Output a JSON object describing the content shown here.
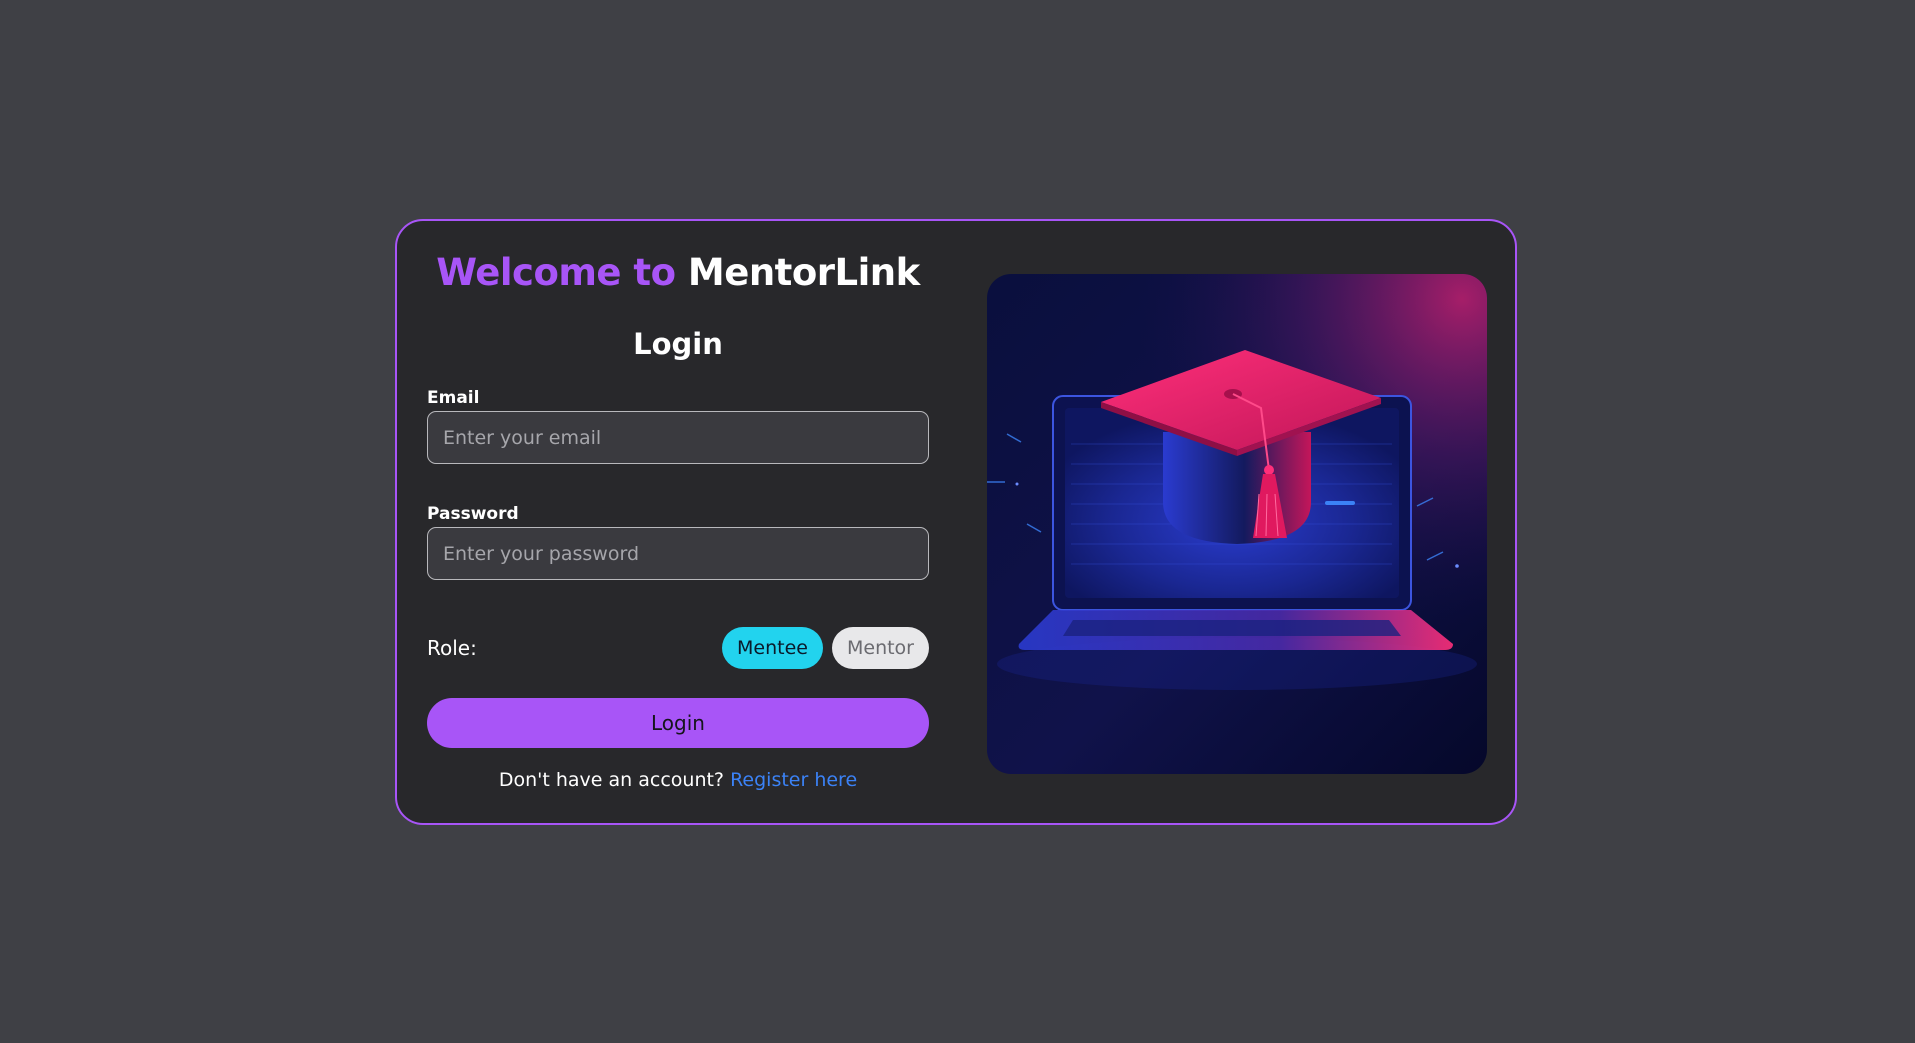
{
  "header": {
    "welcome_prefix": "Welcome to",
    "brand_name": "MentorLink"
  },
  "form": {
    "title": "Login",
    "email_label": "Email",
    "email_placeholder": "Enter your email",
    "email_value": "",
    "password_label": "Password",
    "password_placeholder": "Enter your password",
    "password_value": "",
    "role_label": "Role:",
    "roles": [
      {
        "label": "Mentee",
        "selected": true
      },
      {
        "label": "Mentor",
        "selected": false
      }
    ],
    "submit_label": "Login",
    "register_prompt": "Don't have an account?",
    "register_link": "Register here"
  },
  "illustration": {
    "icon": "graduation-cap-on-laptop-illustration"
  },
  "colors": {
    "page_background": "#3f4045",
    "card_background": "#28282b",
    "accent": "#a855f7",
    "role_selected": "#22d3ee",
    "role_unselected": "#e8e8ea",
    "link": "#3b82f6"
  }
}
